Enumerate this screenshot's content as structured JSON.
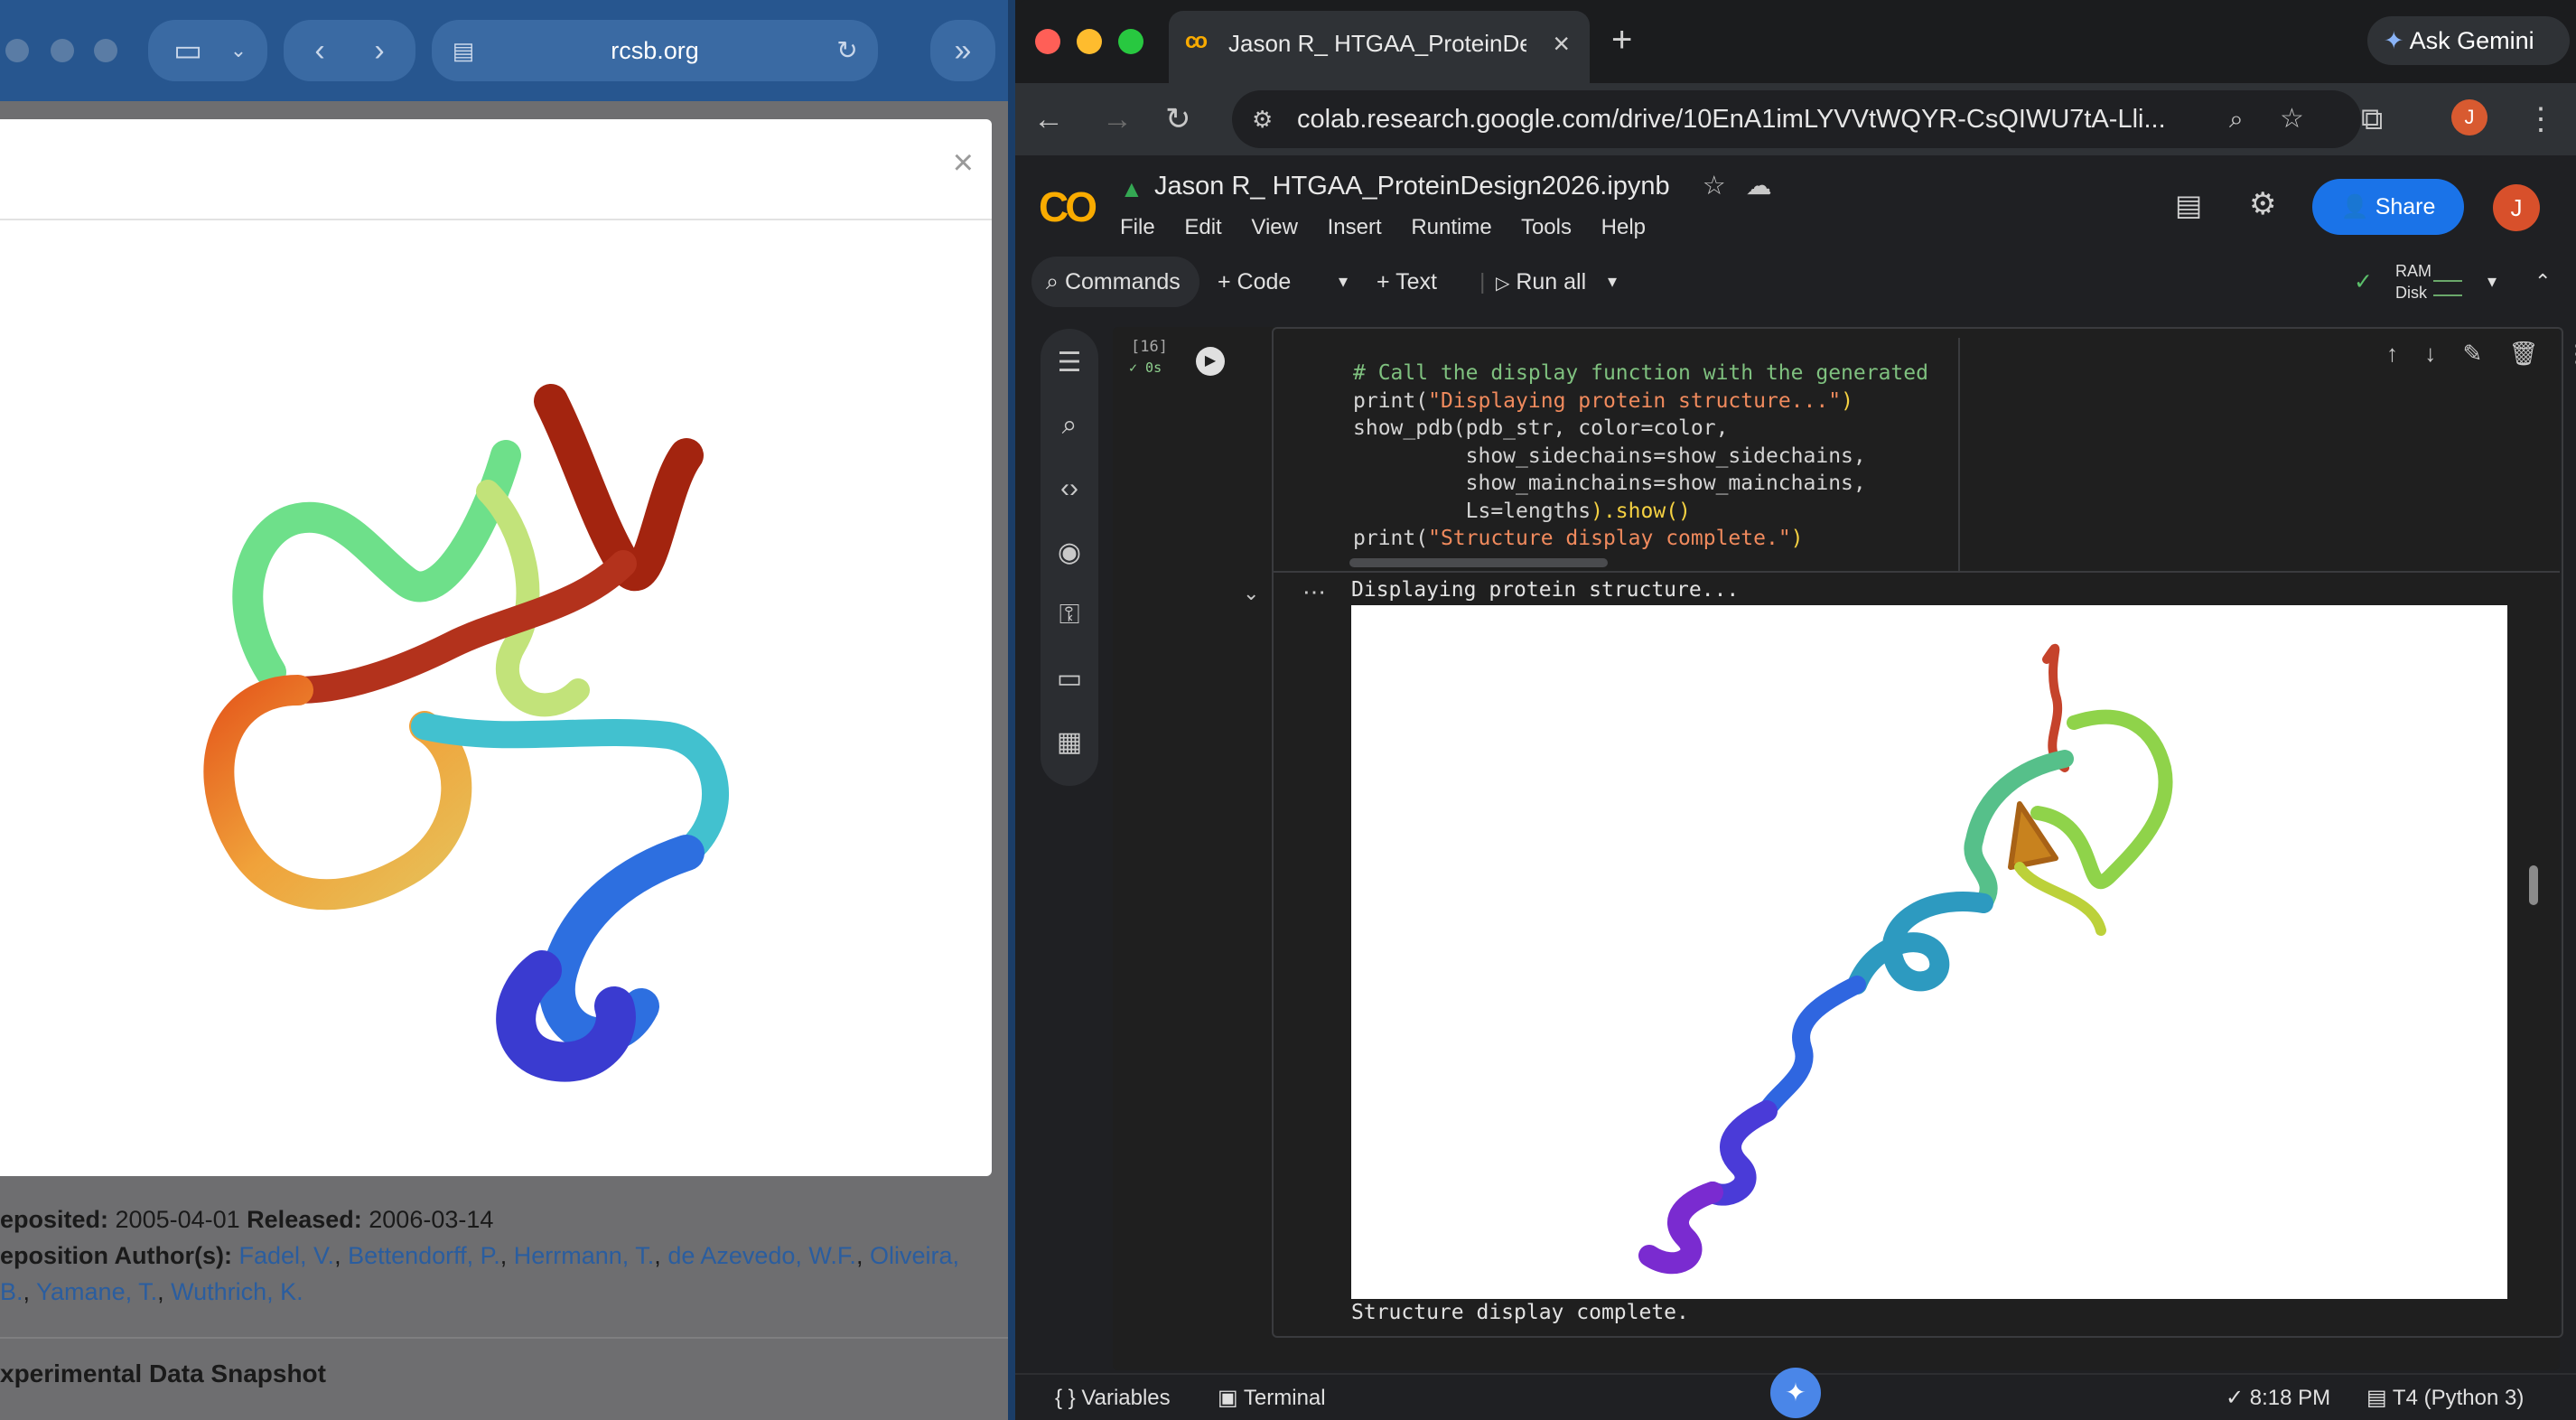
{
  "safari": {
    "url": "rcsb.org",
    "modal_close": "×",
    "deposited_label": "eposited:",
    "deposited_value": "2005-04-01",
    "released_label": "Released:",
    "released_value": "2006-03-14",
    "authors_label": "eposition Author(s):",
    "authors_line1": [
      "Fadel, V.",
      "Bettendorff, P.",
      "Herrmann, T.",
      "de Azevedo, W.F.",
      "Oliveira,"
    ],
    "authors_line2": [
      "B.",
      "Yamane, T.",
      "Wuthrich, K."
    ],
    "snapshot_heading": "xperimental Data Snapshot"
  },
  "chrome": {
    "tab_title": "Jason R_ HTGAA_ProteinDes",
    "tab_close": "×",
    "new_tab": "+",
    "ask_gemini": "Ask Gemini",
    "url": "colab.research.google.com/drive/10EnA1imLYVVtWQYR-CsQIWU7tA-Lli...",
    "profile_initial": "J"
  },
  "colab": {
    "logo": "CO",
    "notebook_title": "Jason R_ HTGAA_ProteinDesign2026.ipynb",
    "menu": [
      "File",
      "Edit",
      "View",
      "Insert",
      "Runtime",
      "Tools",
      "Help"
    ],
    "share_label": "Share",
    "avatar_initial": "J",
    "toolbar": {
      "commands": "Commands",
      "code": "+ Code",
      "text": "+ Text",
      "run_all": "Run all",
      "ram": "RAM",
      "disk": "Disk"
    },
    "cell": {
      "exec_count": "[16]",
      "exec_time": "✓ 0s",
      "code_lines": {
        "l1": "# Call the display function with the generated PD",
        "l2a": "print(",
        "l2b": "\"Displaying protein structure...\"",
        "l2c": ")",
        "l3a": "show_pdb(",
        "l3b": "pdb_str, color=color,",
        "l4": "         show_sidechains=show_sidechains,",
        "l5": "         show_mainchains=show_mainchains,",
        "l6a": "         Ls=lengths",
        "l6b": ").show()",
        "l7a": "print(",
        "l7b": "\"Structure display complete.\"",
        "l7c": ")"
      },
      "output_line1": "Displaying protein structure...",
      "output_line2": "Structure display complete."
    },
    "status": {
      "variables": "Variables",
      "terminal": "Terminal",
      "time": "8:18 PM",
      "runtime": "T4 (Python 3)"
    }
  }
}
